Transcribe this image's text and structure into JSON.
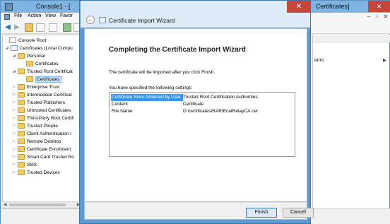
{
  "mmc": {
    "title": "Console1 - [",
    "title_right": "Certificates]",
    "menu": [
      "File",
      "Action",
      "View",
      "Favor"
    ],
    "tree": {
      "items": [
        {
          "label": "Console Root",
          "icon": "console-icon",
          "level": 0,
          "expander": ""
        },
        {
          "label": "Certificates (Local Compu",
          "icon": "certificate-icon",
          "level": 1,
          "expander": "◢"
        },
        {
          "label": "Personal",
          "icon": "folder-icon",
          "level": 2,
          "expander": "◢"
        },
        {
          "label": "Certificates",
          "icon": "folder-icon",
          "level": 3,
          "expander": ""
        },
        {
          "label": "Trusted Root Certificat",
          "icon": "folder-icon",
          "level": 2,
          "expander": "◢"
        },
        {
          "label": "Certificates",
          "icon": "folder-icon",
          "level": 3,
          "expander": "",
          "selected": true
        },
        {
          "label": "Enterprise Trust",
          "icon": "folder-icon",
          "level": 2,
          "expander": "▷"
        },
        {
          "label": "Intermediate Certificat",
          "icon": "folder-icon",
          "level": 2,
          "expander": "▷"
        },
        {
          "label": "Trusted Publishers",
          "icon": "folder-icon",
          "level": 2,
          "expander": "▷"
        },
        {
          "label": "Untrusted Certificates",
          "icon": "folder-icon",
          "level": 2,
          "expander": "▷"
        },
        {
          "label": "Third-Party Root Certifi",
          "icon": "folder-icon",
          "level": 2,
          "expander": "▷"
        },
        {
          "label": "Trusted People",
          "icon": "folder-icon",
          "level": 2,
          "expander": "▷"
        },
        {
          "label": "Client Authentication I",
          "icon": "folder-icon",
          "level": 2,
          "expander": "▷"
        },
        {
          "label": "Remote Desktop",
          "icon": "folder-icon",
          "level": 2,
          "expander": "▷"
        },
        {
          "label": "Certificate Enrollment",
          "icon": "folder-icon",
          "level": 2,
          "expander": "▷"
        },
        {
          "label": "Smart Card Trusted Ro",
          "icon": "folder-icon",
          "level": 2,
          "expander": "▷"
        },
        {
          "label": "SMS",
          "icon": "folder-icon",
          "level": 2,
          "expander": "▷"
        },
        {
          "label": "Trusted Devices",
          "icon": "folder-icon",
          "level": 2,
          "expander": "▷"
        }
      ]
    },
    "actions": {
      "partial_label": "ions"
    }
  },
  "wizard": {
    "title": "Certificate Import Wizard",
    "heading": "Completing the Certificate Import Wizard",
    "intro": "The certificate will be imported after you click Finish.",
    "settings_label": "You have specified the following settings:",
    "settings": [
      {
        "key": "Certificate Store Selected by User",
        "value": "Trusted Root Certification Authorities",
        "selected": true
      },
      {
        "key": "Content",
        "value": "Certificate"
      },
      {
        "key": "File Name",
        "value": "D:\\certificates\\RAR\\EcatRelayCA.cer"
      }
    ],
    "finish_label": "Finish",
    "cancel_label": "Cancel"
  },
  "colors": {
    "accent": "#3399ff",
    "titlebar": "#7eb4df",
    "close": "#c7463a"
  }
}
